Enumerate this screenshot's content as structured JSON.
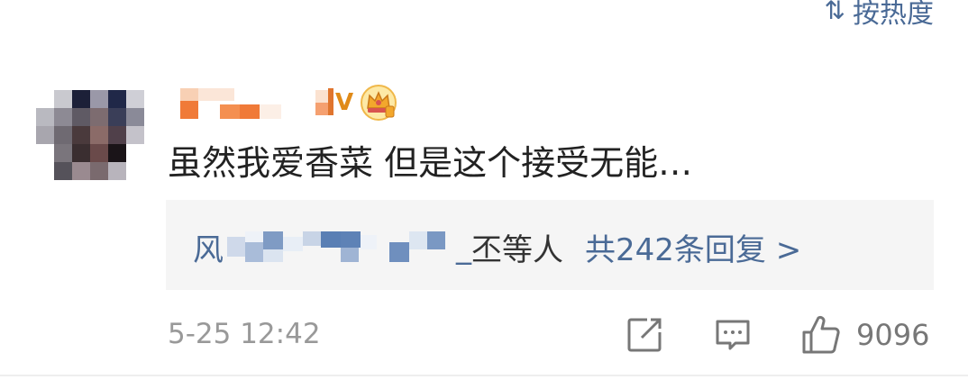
{
  "sort": {
    "icon": "sort-icon",
    "label": "按热度"
  },
  "comment": {
    "username_suffix": "V",
    "badges": [
      "verified-v-icon",
      "crown-vip-icon"
    ],
    "text": "虽然我爱香菜 但是这个接受无能…",
    "replies": {
      "user_prefix": "风",
      "user_suffix": "_",
      "others": "丕等人",
      "count_label": "共242条回复 >"
    },
    "timestamp": "5-25 12:42",
    "actions": {
      "share_icon": "share-icon",
      "comment_icon": "comment-icon",
      "like_icon": "thumbs-up-icon",
      "like_count": "9096"
    }
  },
  "colors": {
    "link": "#4a6a96",
    "text": "#222222",
    "meta": "#999999",
    "reply_bg": "#f5f5f5",
    "accent": "#e08a18"
  }
}
